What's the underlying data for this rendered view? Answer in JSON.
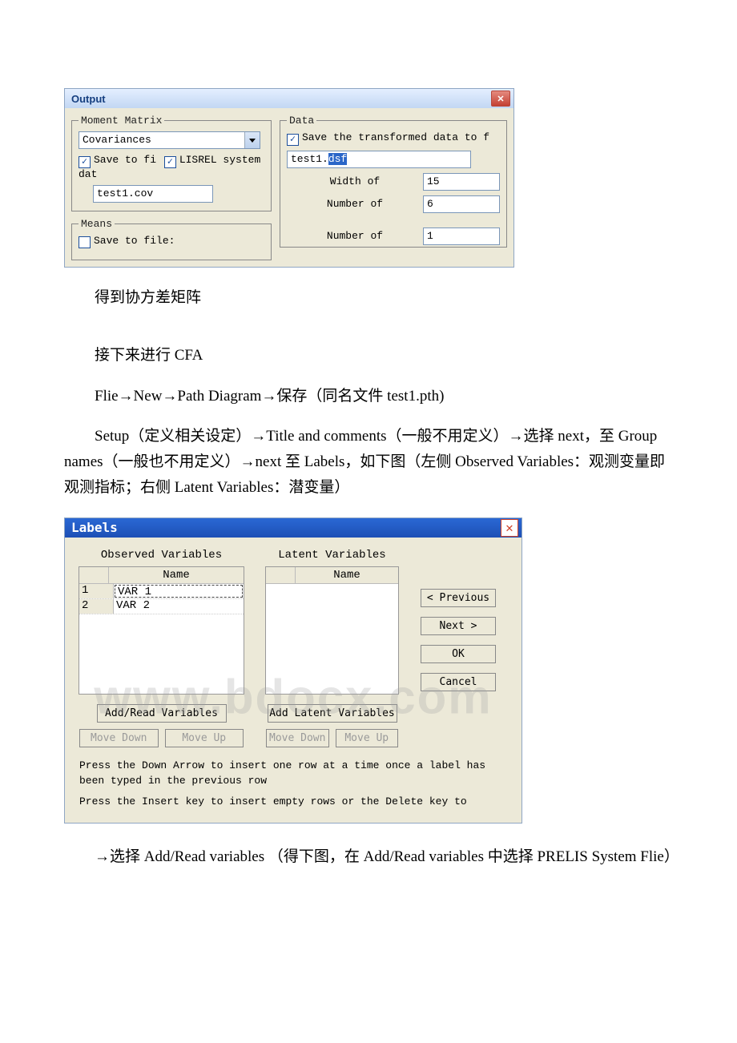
{
  "output": {
    "title": "Output",
    "moment": {
      "legend": "Moment Matrix",
      "select": "Covariances",
      "save_to_fi": "Save to fi",
      "lisrel": "LISREL system dat",
      "file": "test1.cov"
    },
    "means": {
      "legend": "Means",
      "save": "Save to file:"
    },
    "data": {
      "legend": "Data",
      "save_trans": "Save the transformed data to f",
      "file_prefix": "test1.",
      "file_ext": "dsf",
      "width_lbl": "Width of",
      "width_val": "15",
      "num1_lbl": "Number of",
      "num1_val": "6",
      "num2_lbl": "Number of",
      "num2_val": "1"
    }
  },
  "text": {
    "p1": "得到协方差矩阵",
    "p2": "接下来进行 CFA",
    "p3": "Flie→New→Path Diagram→保存（同名文件 test1.pth)",
    "p4": "Setup（定义相关设定）→Title and comments（一般不用定义）→选择 next，至 Group names（一般也不用定义）→next 至 Labels，如下图（左侧 Observed Variables：观测变量即观测指标；右侧 Latent Variables：潜变量）",
    "p5": "→选择 Add/Read variables （得下图，在 Add/Read variables 中选择 PRELIS System Flie）"
  },
  "labels": {
    "title": "Labels",
    "watermark": "www.bdocx.com",
    "obs_head": "Observed Variables",
    "lat_head": "Latent Variables",
    "name": "Name",
    "rows": [
      {
        "idx": "1",
        "val": "VAR 1"
      },
      {
        "idx": "2",
        "val": "VAR 2"
      }
    ],
    "add_read": "Add/Read Variables",
    "add_latent": "Add Latent Variables",
    "move_down": "Move Down",
    "move_up": "Move Up",
    "prev": "< Previous",
    "next": "Next >",
    "ok": "OK",
    "cancel": "Cancel",
    "hint1": "Press the Down Arrow to insert one row at a time once a label has been typed in the previous row",
    "hint2": "Press the Insert key to insert empty rows or the Delete key to"
  }
}
